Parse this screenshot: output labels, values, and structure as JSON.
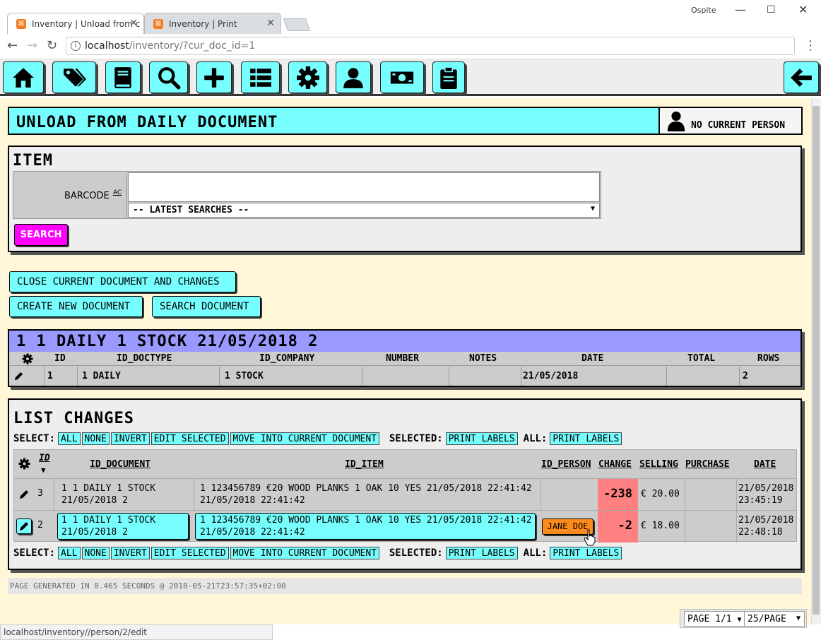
{
  "browser": {
    "tabs": [
      {
        "title": "Inventory | Unload from c"
      },
      {
        "title": "Inventory | Print"
      }
    ],
    "url_host": "localhost",
    "url_path": "/inventory/?cur_doc_id=1",
    "window_user": "Ospite",
    "status_url": "localhost/inventory//person/2/edit"
  },
  "toolbar": {
    "icons": [
      "home-icon",
      "tags-icon",
      "book-icon",
      "search-icon",
      "plus-icon",
      "list-icon",
      "gear-icon",
      "user-icon",
      "money-icon",
      "clipboard-icon",
      "back-arrow-icon"
    ]
  },
  "header": {
    "title": "UNLOAD FROM DAILY DOCUMENT",
    "person": "NO CURRENT PERSON"
  },
  "item": {
    "title": "ITEM",
    "barcode_label": "BARCODE",
    "barcode_sup": "AC",
    "barcode_value": "",
    "latest_searches": "-- LATEST SEARCHES --",
    "search_button": "SEARCH"
  },
  "actions": {
    "close_doc": "CLOSE CURRENT DOCUMENT AND CHANGES",
    "create_doc": "CREATE NEW DOCUMENT",
    "search_doc": "SEARCH DOCUMENT"
  },
  "document": {
    "title": "1 1 DAILY 1 STOCK 21/05/2018 2",
    "columns": [
      "ID",
      "ID_DOCTYPE",
      "ID_COMPANY",
      "NUMBER",
      "NOTES",
      "DATE",
      "TOTAL",
      "ROWS"
    ],
    "row": [
      "1",
      "1 DAILY",
      "1 STOCK",
      "",
      "",
      "21/05/2018",
      "",
      "2"
    ]
  },
  "changes": {
    "title": "LIST CHANGES",
    "select_label": "SELECT:",
    "select_buttons": [
      "ALL",
      "NONE",
      "INVERT",
      "EDIT SELECTED",
      "MOVE INTO CURRENT DOCUMENT"
    ],
    "selected_label": "SELECTED:",
    "print_labels": "PRINT LABELS",
    "all_label": "ALL:",
    "columns": {
      "id": "ID",
      "sort": "▼",
      "id_document": "ID_DOCUMENT",
      "id_item": "ID_ITEM",
      "id_person": "ID_PERSON",
      "change": "CHANGE",
      "selling": "SELLING",
      "purchase": "PURCHASE",
      "date": "DATE"
    },
    "rows": [
      {
        "id": "3",
        "doc_l1": "1 1 DAILY 1 STOCK",
        "doc_l2": "21/05/2018 2",
        "item_l1": "1 123456789 €20 WOOD PLANKS 1 OAK 10 YES 21/05/2018 22:41:42",
        "item_l2": "21/05/2018 22:41:42",
        "person": "",
        "change": "-238",
        "selling": "€ 20.00",
        "purchase": "",
        "date_l1": "21/05/2018",
        "date_l2": "23:45:19"
      },
      {
        "id": "2",
        "doc_l1": "1 1 DAILY 1 STOCK",
        "doc_l2": "21/05/2018 2",
        "item_l1": "1 123456789 €20 WOOD PLANKS 1 OAK 10 YES 21/05/2018 22:41:42",
        "item_l2": "21/05/2018 22:41:42",
        "person": "JANE DOE",
        "change": "-2",
        "selling": "€ 18.00",
        "purchase": "",
        "date_l1": "21/05/2018",
        "date_l2": "22:48:18"
      }
    ]
  },
  "footer": {
    "generated": "PAGE GENERATED IN 0.465 SECONDS @ 2018-05-21T23:57:35+02:00"
  },
  "pager": {
    "page": "PAGE 1/1",
    "per_page": "25/PAGE"
  },
  "colors": {
    "accent": "#77ffff",
    "doc_header": "#9999ff",
    "change_negative": "#ff8080",
    "person_badge": "#ff8c1a",
    "search_button": "#ff00ff",
    "page_bg": "#fff7d8"
  }
}
